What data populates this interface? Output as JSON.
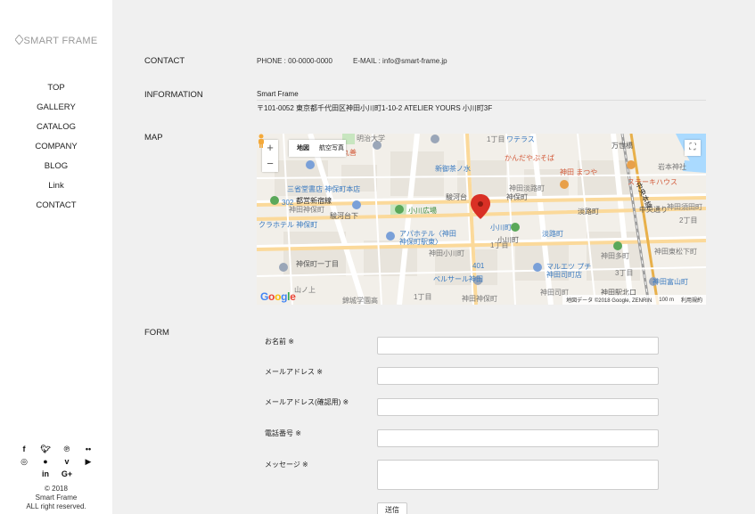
{
  "brand": {
    "logo_text": "SMART FRAME"
  },
  "nav": [
    "TOP",
    "GALLERY",
    "CATALOG",
    "COMPANY",
    "BLOG",
    "Link",
    "CONTACT"
  ],
  "social": {
    "row1": [
      "f",
      "y",
      "p",
      "fl"
    ],
    "row2": [
      "ig",
      "ln",
      "v",
      "yt"
    ],
    "row3": [
      "in",
      "G+"
    ]
  },
  "footer": {
    "line1": "© 2018",
    "line2": "Smart Frame",
    "line3": "ALL right reserved."
  },
  "contact": {
    "label": "CONTACT",
    "phone": "PHONE : 00-0000-0000",
    "email": "E-MAIL : info@smart-frame.jp"
  },
  "information": {
    "label": "INFORMATION",
    "name": "Smart Frame",
    "address": "〒101-0052 東京都千代田区神田小川町1-10-2 ATELIER YOURS 小川町3F"
  },
  "map": {
    "label": "MAP",
    "type_map": "地図",
    "type_satellite": "航空写真",
    "zoom_in": "+",
    "zoom_out": "−",
    "fullscreen": "⛶",
    "google": "Google",
    "footer_data": "地図データ ©2018 Google, ZENRIN",
    "footer_scale": "100 m",
    "footer_terms": "利用規約",
    "places": [
      "明治大学",
      "し丸善",
      "新御茶ノ水",
      "三省堂書店 神保町本店",
      "都営新宿線",
      "神田神保町",
      "クラホテル 神保町",
      "小川広場",
      "アパホテル〈神田",
      "神保町駅東〉",
      "神田小川町",
      "小川町",
      "淡路町",
      "ベルサール神田",
      "マルエツ プチ",
      "神田司町店",
      "神田 まつや",
      "ステーキハウス",
      "かんだやぶそば",
      "神田淡路町",
      "神田多町",
      "神田東松下町",
      "神田富山町",
      "錦城学園高",
      "ワテラス",
      "万世橋",
      "岩本神社",
      "1丁目",
      "2丁目",
      "3丁目",
      "神田須田町",
      "中央本線",
      "神田司町",
      "神田駅北口",
      "中央通り",
      "山ノ上",
      "駿河台",
      "神保町",
      "駿河台下",
      "神保町一丁目",
      "淡路町",
      "小川町",
      "401",
      "302",
      "1丁目",
      "1丁目",
      "神田神保町"
    ]
  },
  "form": {
    "label": "FORM",
    "name_label": "お名前 ※",
    "email_label": "メールアドレス ※",
    "email_confirm_label": "メールアドレス(確認用) ※",
    "phone_label": "電話番号 ※",
    "message_label": "メッセージ ※",
    "submit_label": "送信"
  },
  "colors": {
    "accent": "#e53935",
    "sidebar_bg": "#ffffff",
    "main_bg": "#f0f0f0",
    "map_pin": "#d93025"
  }
}
